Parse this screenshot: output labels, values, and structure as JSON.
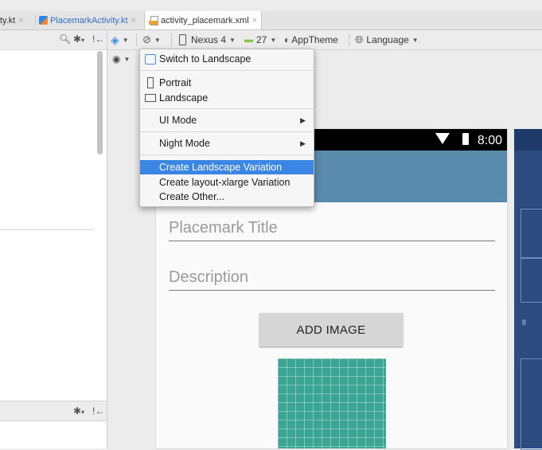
{
  "tabs": [
    {
      "label": "ty.kt",
      "icon": "none"
    },
    {
      "label": "PlacemarkActivity.kt",
      "icon": "kotlin-file-icon"
    },
    {
      "label": "activity_placemark.xml",
      "icon": "xml-layout-icon"
    }
  ],
  "tab_close": "×",
  "toolbar": {
    "device": "Nexus 4",
    "api": "27",
    "theme": "AppTheme",
    "language": "Language"
  },
  "menu": {
    "switch": "Switch to Landscape",
    "portrait": "Portrait",
    "landscape": "Landscape",
    "ui_mode": "UI Mode",
    "night_mode": "Night Mode",
    "create_landscape": "Create Landscape Variation",
    "create_xlarge": "Create layout-xlarge Variation",
    "create_other": "Create Other..."
  },
  "preview": {
    "time": "8:00",
    "title_hint": "Placemark Title",
    "description_hint": "Description",
    "add_image": "ADD IMAGE"
  },
  "blueprint": {
    "margin_label": "8"
  },
  "colors": {
    "appbar": "#5b8bac",
    "selection": "#3b86e4",
    "blueprint": "#2c4b7e",
    "image_placeholder": "#3aa593"
  }
}
